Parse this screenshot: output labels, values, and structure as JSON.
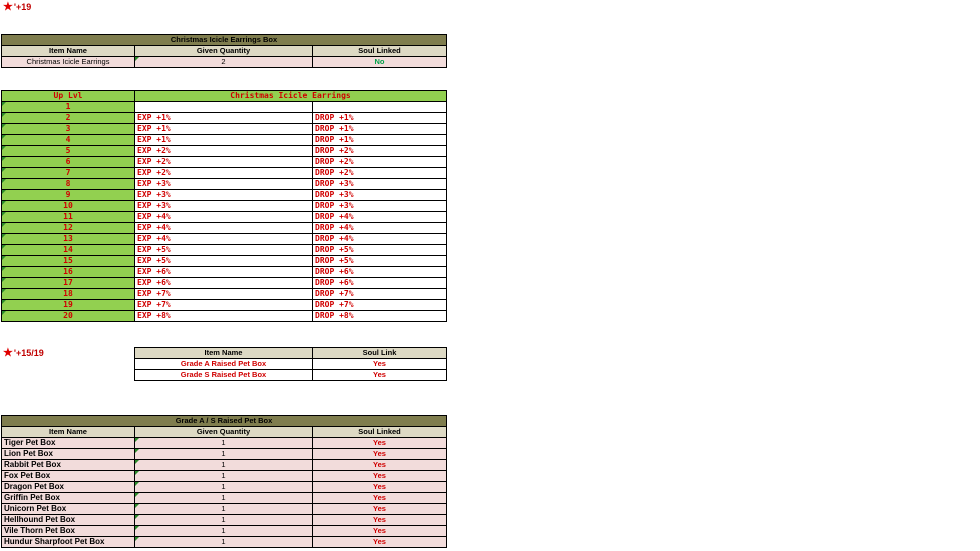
{
  "section1": {
    "label": "'+19",
    "box_title": "Christmas Icicle Earrings Box",
    "headers": [
      "Item Name",
      "Given Quantity",
      "Soul Linked"
    ],
    "row": {
      "name": "Christmas Icicle Earrings",
      "qty": "2",
      "soul": "No"
    }
  },
  "levels": {
    "header_lvl": "Up Lvl",
    "header_item": "Christmas Icicle Earrings",
    "rows": [
      {
        "lvl": "1",
        "exp": "",
        "drop": ""
      },
      {
        "lvl": "2",
        "exp": "EXP +1%",
        "drop": "DROP +1%"
      },
      {
        "lvl": "3",
        "exp": "EXP +1%",
        "drop": "DROP +1%"
      },
      {
        "lvl": "4",
        "exp": "EXP +1%",
        "drop": "DROP +1%"
      },
      {
        "lvl": "5",
        "exp": "EXP +2%",
        "drop": "DROP +2%"
      },
      {
        "lvl": "6",
        "exp": "EXP +2%",
        "drop": "DROP +2%"
      },
      {
        "lvl": "7",
        "exp": "EXP +2%",
        "drop": "DROP +2%"
      },
      {
        "lvl": "8",
        "exp": "EXP +3%",
        "drop": "DROP +3%"
      },
      {
        "lvl": "9",
        "exp": "EXP +3%",
        "drop": "DROP +3%"
      },
      {
        "lvl": "10",
        "exp": "EXP +3%",
        "drop": "DROP +3%"
      },
      {
        "lvl": "11",
        "exp": "EXP +4%",
        "drop": "DROP +4%"
      },
      {
        "lvl": "12",
        "exp": "EXP +4%",
        "drop": "DROP +4%"
      },
      {
        "lvl": "13",
        "exp": "EXP +4%",
        "drop": "DROP +4%"
      },
      {
        "lvl": "14",
        "exp": "EXP +5%",
        "drop": "DROP +5%"
      },
      {
        "lvl": "15",
        "exp": "EXP +5%",
        "drop": "DROP +5%"
      },
      {
        "lvl": "16",
        "exp": "EXP +6%",
        "drop": "DROP +6%"
      },
      {
        "lvl": "17",
        "exp": "EXP +6%",
        "drop": "DROP +6%"
      },
      {
        "lvl": "18",
        "exp": "EXP +7%",
        "drop": "DROP +7%"
      },
      {
        "lvl": "19",
        "exp": "EXP +7%",
        "drop": "DROP +7%"
      },
      {
        "lvl": "20",
        "exp": "EXP +8%",
        "drop": "DROP +8%"
      }
    ]
  },
  "section2": {
    "label": "'+15/19",
    "headers": [
      "Item Name",
      "Soul Link"
    ],
    "rows": [
      {
        "name": "Grade A Raised Pet Box",
        "soul": "Yes"
      },
      {
        "name": "Grade S Raised Pet Box",
        "soul": "Yes"
      }
    ]
  },
  "section3": {
    "box_title": "Grade A / S Raised Pet Box",
    "headers": [
      "Item Name",
      "Given Quantity",
      "Soul Linked"
    ],
    "rows": [
      {
        "name": "Tiger Pet Box",
        "qty": "1",
        "soul": "Yes"
      },
      {
        "name": "Lion Pet Box",
        "qty": "1",
        "soul": "Yes"
      },
      {
        "name": "Rabbit Pet Box",
        "qty": "1",
        "soul": "Yes"
      },
      {
        "name": "Fox Pet Box",
        "qty": "1",
        "soul": "Yes"
      },
      {
        "name": "Dragon Pet Box",
        "qty": "1",
        "soul": "Yes"
      },
      {
        "name": "Griffin Pet Box",
        "qty": "1",
        "soul": "Yes"
      },
      {
        "name": "Unicorn Pet Box",
        "qty": "1",
        "soul": "Yes"
      },
      {
        "name": "Hellhound Pet Box",
        "qty": "1",
        "soul": "Yes"
      },
      {
        "name": "Vile Thorn Pet Box",
        "qty": "1",
        "soul": "Yes"
      },
      {
        "name": "Hundur Sharpfoot Pet Box",
        "qty": "1",
        "soul": "Yes"
      }
    ]
  }
}
